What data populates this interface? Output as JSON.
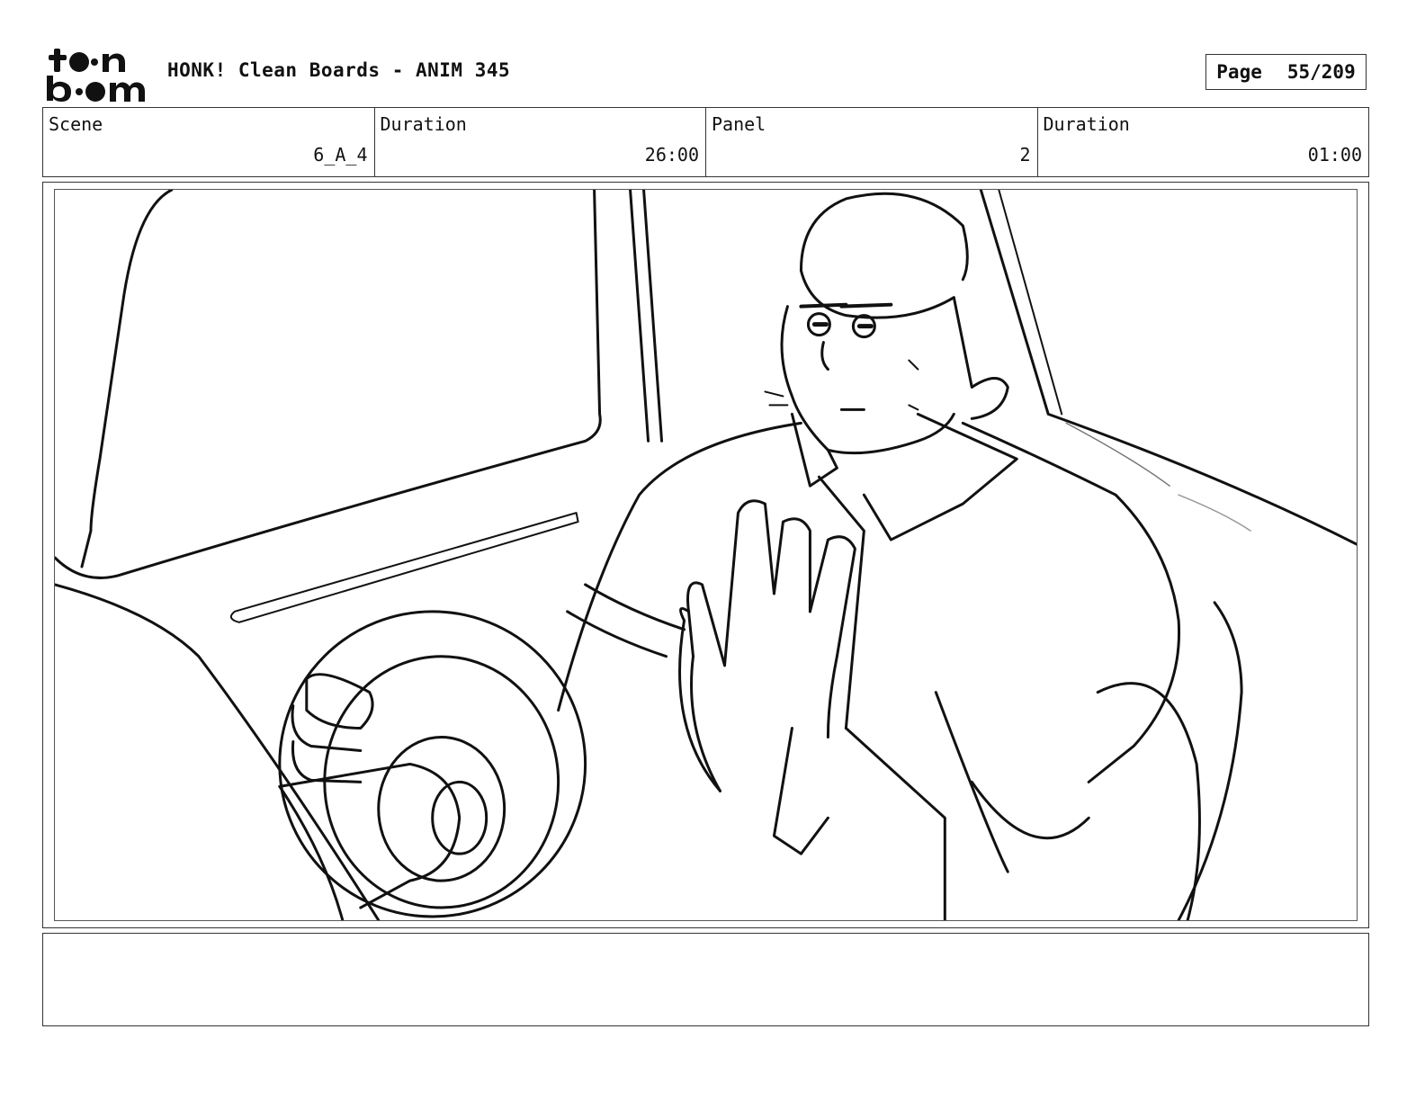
{
  "header": {
    "logo_text": "toon boom",
    "title": "HONK! Clean Boards - ANIM 345",
    "page_label": "Page",
    "page_value": "55/209"
  },
  "info": {
    "scene_label": "Scene",
    "scene_value": "6_A_4",
    "duration_label": "Duration",
    "duration_value": "26:00",
    "panel_label": "Panel",
    "panel_value": "2",
    "panel_duration_label": "Duration",
    "panel_duration_value": "01:00"
  },
  "notes": {
    "text": ""
  }
}
